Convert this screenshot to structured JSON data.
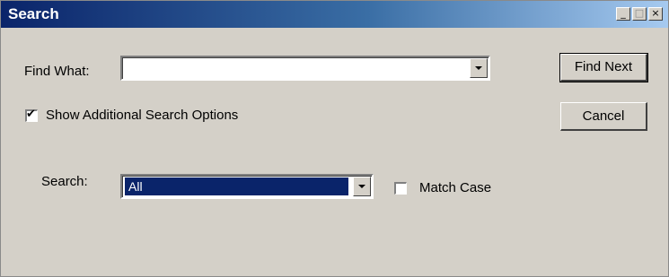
{
  "window": {
    "title": "Search",
    "controls": [
      "_",
      "□",
      "×"
    ]
  },
  "find_what": {
    "label": "Find What:",
    "value": ""
  },
  "show_options": {
    "label": "Show Additional Search Options",
    "checked": true
  },
  "search": {
    "label": "Search:",
    "value": "All"
  },
  "match_case": {
    "label": "Match Case",
    "checked": false
  },
  "buttons": {
    "find_next": "Find Next",
    "cancel": "Cancel"
  },
  "icons": {
    "dropdown": "chevron-down-icon",
    "check": "checkmark-icon"
  },
  "colors": {
    "title_gradient_start": "#0a246a",
    "title_gradient_end": "#a6caf0",
    "selection": "#0a246a",
    "face": "#d4d0c8"
  }
}
